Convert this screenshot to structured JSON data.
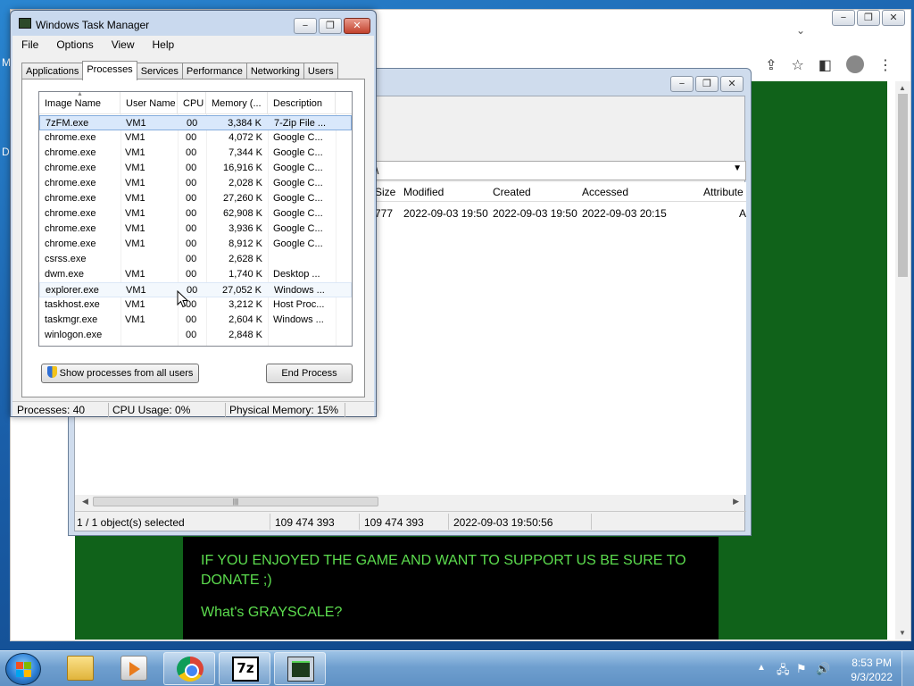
{
  "desktop": {
    "left_letters": [
      "M",
      "D"
    ]
  },
  "chrome": {
    "window_buttons": [
      "−",
      "❐",
      "✕"
    ],
    "page": {
      "line1": "IF YOU ENJOYED THE GAME AND WANT TO SUPPORT US BE SURE TO DONATE ;)",
      "line2": "What's GRAYSCALE?"
    }
  },
  "zip": {
    "window_buttons": [
      "−",
      "❐",
      "✕"
    ],
    "address": "\\",
    "columns": {
      "size": "Size",
      "modified": "Modified",
      "created": "Created",
      "accessed": "Accessed",
      "attributes": "Attribute"
    },
    "row": {
      "size": "777",
      "modified": "2022-09-03 19:50",
      "created": "2022-09-03 19:50",
      "accessed": "2022-09-03 20:15",
      "attributes": "A"
    },
    "status": {
      "selected": "1 / 1 object(s) selected",
      "size": "109 474 393",
      "packed": "109 474 393",
      "date": "2022-09-03 19:50:56"
    }
  },
  "taskmgr": {
    "title": "Windows Task Manager",
    "window_buttons": [
      "−",
      "❐",
      "✕"
    ],
    "menu": [
      "File",
      "Options",
      "View",
      "Help"
    ],
    "tabs": [
      "Applications",
      "Processes",
      "Services",
      "Performance",
      "Networking",
      "Users"
    ],
    "active_tab": "Processes",
    "columns": [
      "Image Name",
      "User Name",
      "CPU",
      "Memory (...",
      "Description"
    ],
    "rows": [
      [
        "7zFM.exe",
        "VM1",
        "00",
        "3,384 K",
        "7-Zip File ..."
      ],
      [
        "chrome.exe",
        "VM1",
        "00",
        "4,072 K",
        "Google C..."
      ],
      [
        "chrome.exe",
        "VM1",
        "00",
        "7,344 K",
        "Google C..."
      ],
      [
        "chrome.exe",
        "VM1",
        "00",
        "16,916 K",
        "Google C..."
      ],
      [
        "chrome.exe",
        "VM1",
        "00",
        "2,028 K",
        "Google C..."
      ],
      [
        "chrome.exe",
        "VM1",
        "00",
        "27,260 K",
        "Google C..."
      ],
      [
        "chrome.exe",
        "VM1",
        "00",
        "62,908 K",
        "Google C..."
      ],
      [
        "chrome.exe",
        "VM1",
        "00",
        "3,936 K",
        "Google C..."
      ],
      [
        "chrome.exe",
        "VM1",
        "00",
        "8,912 K",
        "Google C..."
      ],
      [
        "csrss.exe",
        "",
        "00",
        "2,628 K",
        ""
      ],
      [
        "dwm.exe",
        "VM1",
        "00",
        "1,740 K",
        "Desktop ..."
      ],
      [
        "explorer.exe",
        "VM1",
        "00",
        "27,052 K",
        "Windows ..."
      ],
      [
        "taskhost.exe",
        "VM1",
        "00",
        "3,212 K",
        "Host Proc..."
      ],
      [
        "taskmgr.exe",
        "VM1",
        "00",
        "2,604 K",
        "Windows ..."
      ],
      [
        "winlogon.exe",
        "",
        "00",
        "2,848 K",
        ""
      ]
    ],
    "selected_row": 0,
    "hover_row": 11,
    "show_all_label": "Show processes from all users",
    "end_process_label": "End Process",
    "status": {
      "processes": "Processes: 40",
      "cpu": "CPU Usage: 0%",
      "memory": "Physical Memory: 15%"
    }
  },
  "taskbar": {
    "items": [
      "windows-explorer-icon",
      "media-player-icon",
      "chrome-icon",
      "7zip-icon",
      "task-manager-icon"
    ],
    "zip_icon_text": "7z",
    "clock": {
      "time": "8:53 PM",
      "date": "9/3/2022"
    }
  },
  "colors": {
    "page_green": "#10621a",
    "donate_text": "#5cdc4e",
    "selection": "#d9e8fb"
  }
}
